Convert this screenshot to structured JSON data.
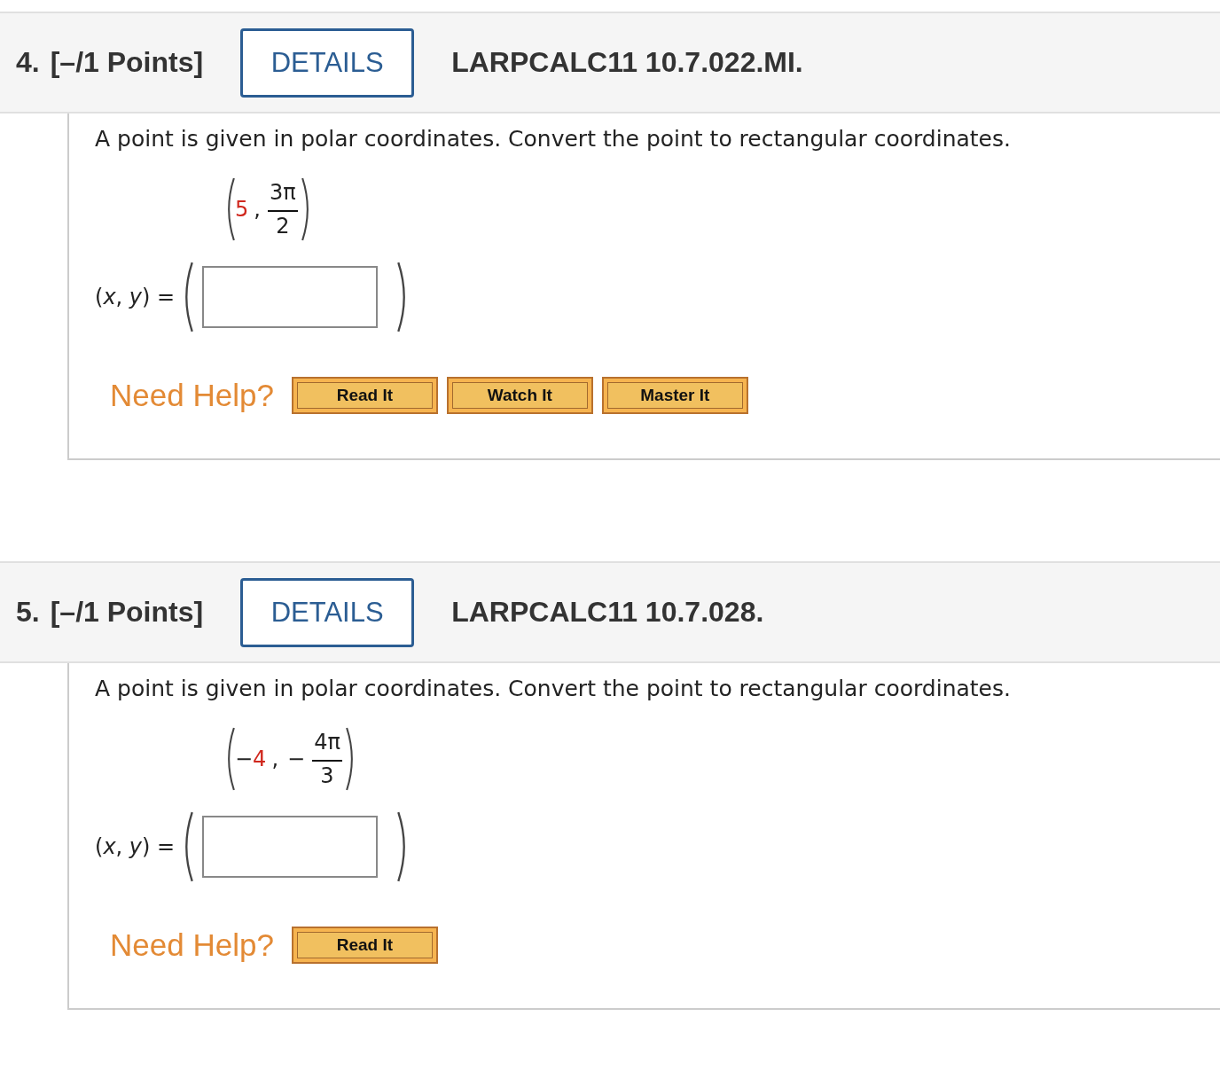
{
  "questions": [
    {
      "number": "4.",
      "points": "[–/1 Points]",
      "details": "DETAILS",
      "code": "LARPCALC11 10.7.022.MI.",
      "prompt": "A point is given in polar coordinates. Convert the point to rectangular coordinates.",
      "point": {
        "r_value": "5",
        "comma": ",",
        "numerator": "3π",
        "denominator": "2"
      },
      "answer_label": "(*x*, *y*) =",
      "help_label": "Need Help?",
      "help_buttons": [
        "Read It",
        "Watch It",
        "Master It"
      ]
    },
    {
      "number": "5.",
      "points": "[–/1 Points]",
      "details": "DETAILS",
      "code": "LARPCALC11 10.7.028.",
      "prompt": "A point is given in polar coordinates. Convert the point to rectangular coordinates.",
      "point": {
        "r_sign": "−",
        "r_value": "4",
        "comma": ",",
        "theta_sign": "−",
        "numerator": "4π",
        "denominator": "3"
      },
      "answer_label": "(*x*, *y*) =",
      "help_label": "Need Help?",
      "help_buttons": [
        "Read It"
      ]
    }
  ]
}
